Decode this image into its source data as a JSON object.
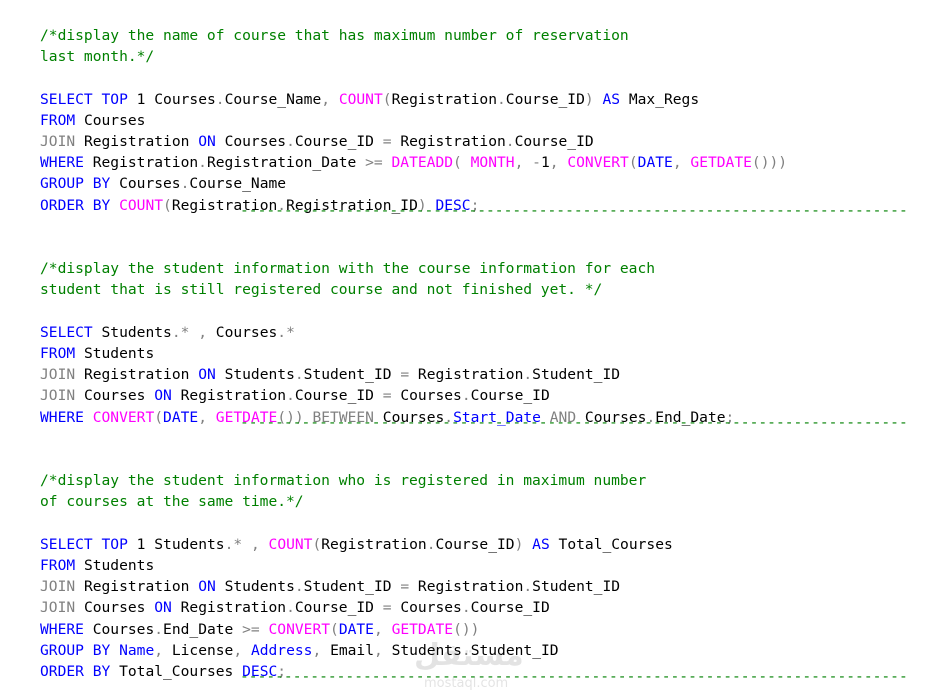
{
  "editor": {
    "separator": "----------------------------------------------------------------------------",
    "colors": {
      "keyword": "#0000ff",
      "function": "#ff00ff",
      "operator": "#808080",
      "comment": "#008000",
      "identifier": "#000000",
      "background": "#ffffff"
    },
    "lines": [
      {
        "kind": "code",
        "tokens": [
          {
            "t": "c",
            "v": "/*display the name of course that has maximum number of reservation"
          }
        ]
      },
      {
        "kind": "code",
        "tokens": [
          {
            "t": "c",
            "v": "last month.*/"
          }
        ]
      },
      {
        "kind": "blank"
      },
      {
        "kind": "code",
        "tokens": [
          {
            "t": "k",
            "v": "SELECT TOP"
          },
          {
            "t": "s",
            "v": " "
          },
          {
            "t": "n",
            "v": "1"
          },
          {
            "t": "s",
            "v": " "
          },
          {
            "t": "i",
            "v": "Courses"
          },
          {
            "t": "g",
            "v": "."
          },
          {
            "t": "i",
            "v": "Course_Name"
          },
          {
            "t": "g",
            "v": ","
          },
          {
            "t": "s",
            "v": " "
          },
          {
            "t": "f",
            "v": "COUNT"
          },
          {
            "t": "g",
            "v": "("
          },
          {
            "t": "i",
            "v": "Registration"
          },
          {
            "t": "g",
            "v": "."
          },
          {
            "t": "i",
            "v": "Course_ID"
          },
          {
            "t": "g",
            "v": ")"
          },
          {
            "t": "s",
            "v": " "
          },
          {
            "t": "k",
            "v": "AS"
          },
          {
            "t": "s",
            "v": " "
          },
          {
            "t": "i",
            "v": "Max_Regs"
          }
        ]
      },
      {
        "kind": "code",
        "tokens": [
          {
            "t": "k",
            "v": "FROM"
          },
          {
            "t": "s",
            "v": " "
          },
          {
            "t": "i",
            "v": "Courses"
          }
        ]
      },
      {
        "kind": "code",
        "tokens": [
          {
            "t": "g",
            "v": "JOIN"
          },
          {
            "t": "s",
            "v": " "
          },
          {
            "t": "i",
            "v": "Registration"
          },
          {
            "t": "s",
            "v": " "
          },
          {
            "t": "k",
            "v": "ON"
          },
          {
            "t": "s",
            "v": " "
          },
          {
            "t": "i",
            "v": "Courses"
          },
          {
            "t": "g",
            "v": "."
          },
          {
            "t": "i",
            "v": "Course_ID"
          },
          {
            "t": "s",
            "v": " "
          },
          {
            "t": "g",
            "v": "="
          },
          {
            "t": "s",
            "v": " "
          },
          {
            "t": "i",
            "v": "Registration"
          },
          {
            "t": "g",
            "v": "."
          },
          {
            "t": "i",
            "v": "Course_ID"
          }
        ]
      },
      {
        "kind": "code",
        "tokens": [
          {
            "t": "k",
            "v": "WHERE"
          },
          {
            "t": "s",
            "v": " "
          },
          {
            "t": "i",
            "v": "Registration"
          },
          {
            "t": "g",
            "v": "."
          },
          {
            "t": "i",
            "v": "Registration_Date"
          },
          {
            "t": "s",
            "v": " "
          },
          {
            "t": "g",
            "v": ">="
          },
          {
            "t": "s",
            "v": " "
          },
          {
            "t": "f",
            "v": "DATEADD"
          },
          {
            "t": "g",
            "v": "("
          },
          {
            "t": "s",
            "v": " "
          },
          {
            "t": "f",
            "v": "MONTH"
          },
          {
            "t": "g",
            "v": ","
          },
          {
            "t": "s",
            "v": " "
          },
          {
            "t": "g",
            "v": "-"
          },
          {
            "t": "n",
            "v": "1"
          },
          {
            "t": "g",
            "v": ","
          },
          {
            "t": "s",
            "v": " "
          },
          {
            "t": "f",
            "v": "CONVERT"
          },
          {
            "t": "g",
            "v": "("
          },
          {
            "t": "k",
            "v": "DATE"
          },
          {
            "t": "g",
            "v": ","
          },
          {
            "t": "s",
            "v": " "
          },
          {
            "t": "f",
            "v": "GETDATE"
          },
          {
            "t": "g",
            "v": "()))"
          }
        ]
      },
      {
        "kind": "code",
        "tokens": [
          {
            "t": "k",
            "v": "GROUP BY"
          },
          {
            "t": "s",
            "v": " "
          },
          {
            "t": "i",
            "v": "Courses"
          },
          {
            "t": "g",
            "v": "."
          },
          {
            "t": "i",
            "v": "Course_Name"
          }
        ]
      },
      {
        "kind": "code",
        "tokens": [
          {
            "t": "k",
            "v": "ORDER BY"
          },
          {
            "t": "s",
            "v": " "
          },
          {
            "t": "f",
            "v": "COUNT"
          },
          {
            "t": "g",
            "v": "("
          },
          {
            "t": "i",
            "v": "Registration"
          },
          {
            "t": "g",
            "v": "."
          },
          {
            "t": "i",
            "v": "Registration_ID"
          },
          {
            "t": "g",
            "v": ")"
          },
          {
            "t": "s",
            "v": " "
          },
          {
            "t": "k",
            "v": "DESC"
          },
          {
            "t": "g",
            "v": ";"
          }
        ]
      },
      {
        "kind": "sep"
      },
      {
        "kind": "blank"
      },
      {
        "kind": "code",
        "tokens": [
          {
            "t": "c",
            "v": "/*display the student information with the course information for each"
          }
        ]
      },
      {
        "kind": "code",
        "tokens": [
          {
            "t": "c",
            "v": "student that is still registered course and not finished yet. */"
          }
        ]
      },
      {
        "kind": "blank"
      },
      {
        "kind": "code",
        "tokens": [
          {
            "t": "k",
            "v": "SELECT"
          },
          {
            "t": "s",
            "v": " "
          },
          {
            "t": "i",
            "v": "Students"
          },
          {
            "t": "g",
            "v": ".*"
          },
          {
            "t": "s",
            "v": " "
          },
          {
            "t": "g",
            "v": ","
          },
          {
            "t": "s",
            "v": " "
          },
          {
            "t": "i",
            "v": "Courses"
          },
          {
            "t": "g",
            "v": ".*"
          }
        ]
      },
      {
        "kind": "code",
        "tokens": [
          {
            "t": "k",
            "v": "FROM"
          },
          {
            "t": "s",
            "v": " "
          },
          {
            "t": "i",
            "v": "Students"
          }
        ]
      },
      {
        "kind": "code",
        "tokens": [
          {
            "t": "g",
            "v": "JOIN"
          },
          {
            "t": "s",
            "v": " "
          },
          {
            "t": "i",
            "v": "Registration"
          },
          {
            "t": "s",
            "v": " "
          },
          {
            "t": "k",
            "v": "ON"
          },
          {
            "t": "s",
            "v": " "
          },
          {
            "t": "i",
            "v": "Students"
          },
          {
            "t": "g",
            "v": "."
          },
          {
            "t": "i",
            "v": "Student_ID"
          },
          {
            "t": "s",
            "v": " "
          },
          {
            "t": "g",
            "v": "="
          },
          {
            "t": "s",
            "v": " "
          },
          {
            "t": "i",
            "v": "Registration"
          },
          {
            "t": "g",
            "v": "."
          },
          {
            "t": "i",
            "v": "Student_ID"
          }
        ]
      },
      {
        "kind": "code",
        "tokens": [
          {
            "t": "g",
            "v": "JOIN"
          },
          {
            "t": "s",
            "v": " "
          },
          {
            "t": "i",
            "v": "Courses"
          },
          {
            "t": "s",
            "v": " "
          },
          {
            "t": "k",
            "v": "ON"
          },
          {
            "t": "s",
            "v": " "
          },
          {
            "t": "i",
            "v": "Registration"
          },
          {
            "t": "g",
            "v": "."
          },
          {
            "t": "i",
            "v": "Course_ID"
          },
          {
            "t": "s",
            "v": " "
          },
          {
            "t": "g",
            "v": "="
          },
          {
            "t": "s",
            "v": " "
          },
          {
            "t": "i",
            "v": "Courses"
          },
          {
            "t": "g",
            "v": "."
          },
          {
            "t": "i",
            "v": "Course_ID"
          }
        ]
      },
      {
        "kind": "code",
        "tokens": [
          {
            "t": "k",
            "v": "WHERE"
          },
          {
            "t": "s",
            "v": " "
          },
          {
            "t": "f",
            "v": "CONVERT"
          },
          {
            "t": "g",
            "v": "("
          },
          {
            "t": "k",
            "v": "DATE"
          },
          {
            "t": "g",
            "v": ","
          },
          {
            "t": "s",
            "v": " "
          },
          {
            "t": "f",
            "v": "GETDATE"
          },
          {
            "t": "g",
            "v": "())"
          },
          {
            "t": "s",
            "v": " "
          },
          {
            "t": "g",
            "v": "BETWEEN"
          },
          {
            "t": "s",
            "v": " "
          },
          {
            "t": "i",
            "v": "Courses"
          },
          {
            "t": "g",
            "v": "."
          },
          {
            "t": "k",
            "v": "Start_Date"
          },
          {
            "t": "s",
            "v": " "
          },
          {
            "t": "g",
            "v": "AND"
          },
          {
            "t": "s",
            "v": " "
          },
          {
            "t": "i",
            "v": "Courses"
          },
          {
            "t": "g",
            "v": "."
          },
          {
            "t": "i",
            "v": "End_Date"
          },
          {
            "t": "g",
            "v": ";"
          }
        ]
      },
      {
        "kind": "sep"
      },
      {
        "kind": "blank"
      },
      {
        "kind": "code",
        "tokens": [
          {
            "t": "c",
            "v": "/*display the student information who is registered in maximum number"
          }
        ]
      },
      {
        "kind": "code",
        "tokens": [
          {
            "t": "c",
            "v": "of courses at the same time.*/"
          }
        ]
      },
      {
        "kind": "blank"
      },
      {
        "kind": "code",
        "tokens": [
          {
            "t": "k",
            "v": "SELECT TOP"
          },
          {
            "t": "s",
            "v": " "
          },
          {
            "t": "n",
            "v": "1"
          },
          {
            "t": "s",
            "v": " "
          },
          {
            "t": "i",
            "v": "Students"
          },
          {
            "t": "g",
            "v": ".*"
          },
          {
            "t": "s",
            "v": " "
          },
          {
            "t": "g",
            "v": ","
          },
          {
            "t": "s",
            "v": " "
          },
          {
            "t": "f",
            "v": "COUNT"
          },
          {
            "t": "g",
            "v": "("
          },
          {
            "t": "i",
            "v": "Registration"
          },
          {
            "t": "g",
            "v": "."
          },
          {
            "t": "i",
            "v": "Course_ID"
          },
          {
            "t": "g",
            "v": ")"
          },
          {
            "t": "s",
            "v": " "
          },
          {
            "t": "k",
            "v": "AS"
          },
          {
            "t": "s",
            "v": " "
          },
          {
            "t": "i",
            "v": "Total_Courses"
          }
        ]
      },
      {
        "kind": "code",
        "tokens": [
          {
            "t": "k",
            "v": "FROM"
          },
          {
            "t": "s",
            "v": " "
          },
          {
            "t": "i",
            "v": "Students"
          }
        ]
      },
      {
        "kind": "code",
        "tokens": [
          {
            "t": "g",
            "v": "JOIN"
          },
          {
            "t": "s",
            "v": " "
          },
          {
            "t": "i",
            "v": "Registration"
          },
          {
            "t": "s",
            "v": " "
          },
          {
            "t": "k",
            "v": "ON"
          },
          {
            "t": "s",
            "v": " "
          },
          {
            "t": "i",
            "v": "Students"
          },
          {
            "t": "g",
            "v": "."
          },
          {
            "t": "i",
            "v": "Student_ID"
          },
          {
            "t": "s",
            "v": " "
          },
          {
            "t": "g",
            "v": "="
          },
          {
            "t": "s",
            "v": " "
          },
          {
            "t": "i",
            "v": "Registration"
          },
          {
            "t": "g",
            "v": "."
          },
          {
            "t": "i",
            "v": "Student_ID"
          }
        ]
      },
      {
        "kind": "code",
        "tokens": [
          {
            "t": "g",
            "v": "JOIN"
          },
          {
            "t": "s",
            "v": " "
          },
          {
            "t": "i",
            "v": "Courses"
          },
          {
            "t": "s",
            "v": " "
          },
          {
            "t": "k",
            "v": "ON"
          },
          {
            "t": "s",
            "v": " "
          },
          {
            "t": "i",
            "v": "Registration"
          },
          {
            "t": "g",
            "v": "."
          },
          {
            "t": "i",
            "v": "Course_ID"
          },
          {
            "t": "s",
            "v": " "
          },
          {
            "t": "g",
            "v": "="
          },
          {
            "t": "s",
            "v": " "
          },
          {
            "t": "i",
            "v": "Courses"
          },
          {
            "t": "g",
            "v": "."
          },
          {
            "t": "i",
            "v": "Course_ID"
          }
        ]
      },
      {
        "kind": "code",
        "tokens": [
          {
            "t": "k",
            "v": "WHERE"
          },
          {
            "t": "s",
            "v": " "
          },
          {
            "t": "i",
            "v": "Courses"
          },
          {
            "t": "g",
            "v": "."
          },
          {
            "t": "i",
            "v": "End_Date"
          },
          {
            "t": "s",
            "v": " "
          },
          {
            "t": "g",
            "v": ">="
          },
          {
            "t": "s",
            "v": " "
          },
          {
            "t": "f",
            "v": "CONVERT"
          },
          {
            "t": "g",
            "v": "("
          },
          {
            "t": "k",
            "v": "DATE"
          },
          {
            "t": "g",
            "v": ","
          },
          {
            "t": "s",
            "v": " "
          },
          {
            "t": "f",
            "v": "GETDATE"
          },
          {
            "t": "g",
            "v": "())"
          }
        ]
      },
      {
        "kind": "code",
        "tokens": [
          {
            "t": "k",
            "v": "GROUP BY"
          },
          {
            "t": "s",
            "v": " "
          },
          {
            "t": "k",
            "v": "Name"
          },
          {
            "t": "g",
            "v": ","
          },
          {
            "t": "s",
            "v": " "
          },
          {
            "t": "i",
            "v": "License"
          },
          {
            "t": "g",
            "v": ","
          },
          {
            "t": "s",
            "v": " "
          },
          {
            "t": "k",
            "v": "Address"
          },
          {
            "t": "g",
            "v": ","
          },
          {
            "t": "s",
            "v": " "
          },
          {
            "t": "i",
            "v": "Email"
          },
          {
            "t": "g",
            "v": ","
          },
          {
            "t": "s",
            "v": " "
          },
          {
            "t": "i",
            "v": "Students"
          },
          {
            "t": "g",
            "v": "."
          },
          {
            "t": "i",
            "v": "Student_ID"
          }
        ]
      },
      {
        "kind": "code",
        "tokens": [
          {
            "t": "k",
            "v": "ORDER BY"
          },
          {
            "t": "s",
            "v": " "
          },
          {
            "t": "i",
            "v": "Total_Courses"
          },
          {
            "t": "s",
            "v": " "
          },
          {
            "t": "k",
            "v": "DESC"
          },
          {
            "t": "g",
            "v": ";"
          }
        ]
      },
      {
        "kind": "sep"
      }
    ]
  },
  "watermark": {
    "glyph": "مستقل",
    "url": "mostaql.com"
  }
}
